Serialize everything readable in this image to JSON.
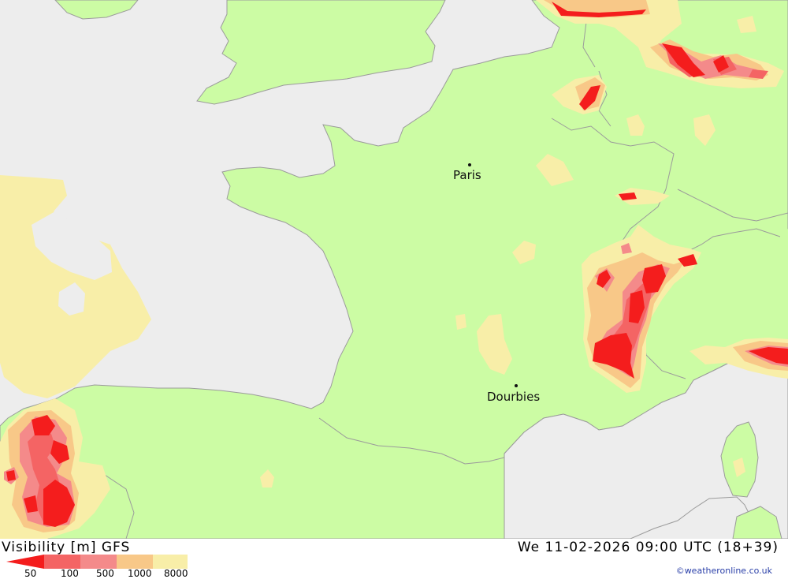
{
  "header": {
    "title": "Visibility [m] GFS",
    "datetime": "We 11-02-2026 09:00 UTC (18+39)"
  },
  "footer": {
    "credit": "©weatheronline.co.uk"
  },
  "legend": {
    "labels": [
      "50",
      "100",
      "500",
      "1000",
      "8000"
    ],
    "colors": [
      "#f41d1d",
      "#f46464",
      "#f48a8a",
      "#f8c888",
      "#f8eea8"
    ]
  },
  "cities": [
    {
      "name": "Paris"
    },
    {
      "name": "Dourbies"
    }
  ],
  "colors": {
    "sea": "#ededed",
    "land": "#ccfca4",
    "border": "#9b9b9b",
    "vis_8000": "#f8eea8",
    "vis_1000": "#f8c888",
    "vis_500": "#f48a8a",
    "vis_100": "#f46464",
    "vis_50": "#f41d1d"
  }
}
